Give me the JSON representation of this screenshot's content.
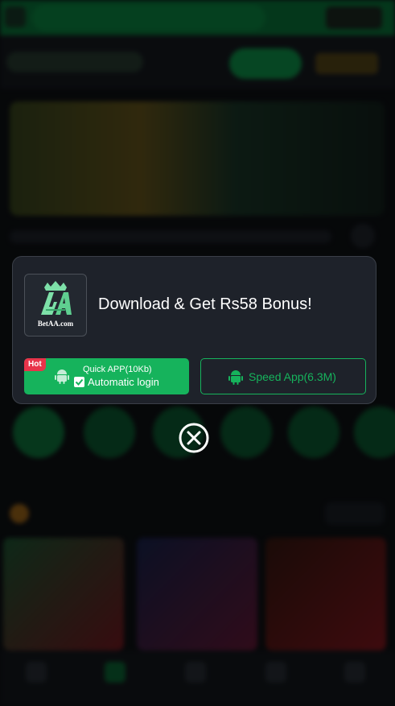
{
  "modal": {
    "logo_text": "BetAA.com",
    "title": "Download & Get Rs58 Bonus!",
    "quick_app": {
      "badge": "Hot",
      "line1": "Quick APP(10Kb)",
      "line2": "Automatic login",
      "icon": "android-icon"
    },
    "speed_app": {
      "label": "Speed App(6.3M)",
      "icon": "android-icon"
    },
    "close_icon": "close-circle-icon"
  },
  "colors": {
    "accent_green": "#16b35c",
    "hot_red": "#e8344a",
    "modal_bg": "#1e222a",
    "text_white": "#ffffff"
  }
}
